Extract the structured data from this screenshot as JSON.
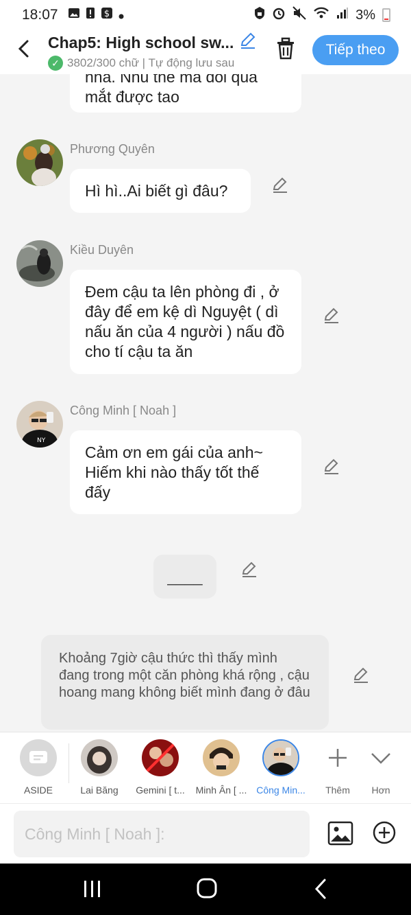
{
  "status": {
    "time": "18:07",
    "battery": "3%"
  },
  "header": {
    "title": "Chap5: High school sw...",
    "subtitle": "3802/300 chữ | Tự động lưu sau",
    "next_label": "Tiếp theo"
  },
  "messages": [
    {
      "text": "nhà. Nhu thế mà đôi qua mắt được tao"
    },
    {
      "name": "Phương Quyên",
      "text": "Hì hì..Ai biết gì đâu?"
    },
    {
      "name": "Kiều Duyên",
      "text": "Đem cậu ta lên phòng đi , ở đây để em kệ dì Nguyệt ( dì nấu ăn của 4 người ) nấu đồ cho tí cậu ta ăn"
    },
    {
      "name": "Công Minh [ Noah ]",
      "text": "Cảm ơn em gái của anh~ Hiếm khi nào thấy tốt thế đấy"
    },
    {
      "text": "____"
    }
  ],
  "narration": "Khoảng 7giờ cậu thức thì thấy mình đang trong một căn phòng khá rộng , cậu hoang mang không biết mình đang ở đâu",
  "characters": [
    {
      "label": "ASIDE"
    },
    {
      "label": "Lai Băng"
    },
    {
      "label": "Gemini [ t..."
    },
    {
      "label": "Minh Ân [ ..."
    },
    {
      "label": "Công Min..."
    }
  ],
  "actions": {
    "more_label": "Thêm",
    "less_label": "Hơn"
  },
  "input": {
    "placeholder": "Công Minh [ Noah ]:"
  },
  "colors": {
    "accent": "#4a9ef2",
    "check": "#4cb96a"
  }
}
